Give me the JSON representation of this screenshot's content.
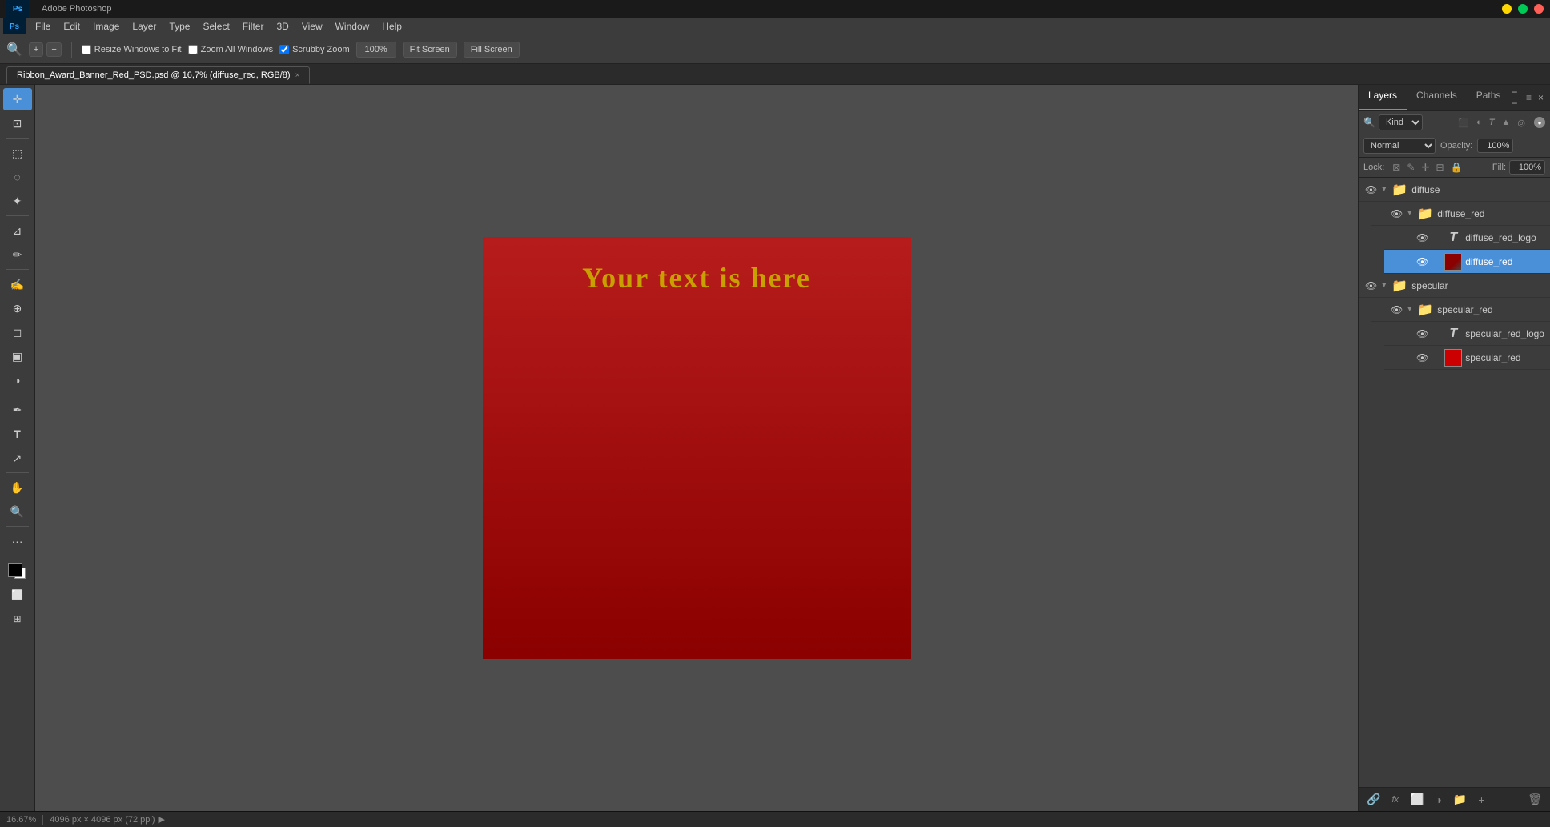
{
  "app": {
    "title": "Adobe Photoshop",
    "ps_logo": "Ps"
  },
  "menubar": {
    "items": [
      "File",
      "Edit",
      "Image",
      "Layer",
      "Type",
      "Select",
      "Filter",
      "3D",
      "View",
      "Window",
      "Help"
    ]
  },
  "optionsbar": {
    "zoom_icon": "🔍",
    "resize_windows_label": "Resize Windows to Fit",
    "zoom_all_label": "Zoom All Windows",
    "scrubby_zoom_label": "Scrubby Zoom",
    "zoom_value": "100%",
    "fit_screen_label": "Fit Screen",
    "fill_screen_label": "Fill Screen"
  },
  "tab": {
    "filename": "Ribbon_Award_Banner_Red_PSD.psd @ 16,7% (diffuse_red, RGB/8)",
    "close_label": "×"
  },
  "canvas": {
    "text": "Your text is here",
    "bg_color": "#8b0000"
  },
  "layers_panel": {
    "tabs": [
      "Layers",
      "Channels",
      "Paths"
    ],
    "active_tab": "Layers",
    "filter_label": "Kind",
    "blend_mode": "Normal",
    "opacity_label": "Opacity:",
    "opacity_value": "100%",
    "lock_label": "Lock:",
    "fill_label": "Fill:",
    "fill_value": "100%",
    "layers": [
      {
        "id": 1,
        "name": "diffuse",
        "type": "group",
        "indent": 0,
        "visible": true,
        "expanded": true
      },
      {
        "id": 2,
        "name": "diffuse_red",
        "type": "group",
        "indent": 1,
        "visible": true,
        "expanded": true
      },
      {
        "id": 3,
        "name": "diffuse_red_logo",
        "type": "text",
        "indent": 2,
        "visible": true
      },
      {
        "id": 4,
        "name": "diffuse_red",
        "type": "pixel",
        "indent": 2,
        "visible": true,
        "selected": true,
        "color": "dark-red"
      },
      {
        "id": 5,
        "name": "specular",
        "type": "group",
        "indent": 0,
        "visible": true,
        "expanded": true
      },
      {
        "id": 6,
        "name": "specular_red",
        "type": "group",
        "indent": 1,
        "visible": true,
        "expanded": true
      },
      {
        "id": 7,
        "name": "specular_red_logo",
        "type": "text",
        "indent": 2,
        "visible": true
      },
      {
        "id": 8,
        "name": "specular_red",
        "type": "pixel",
        "indent": 2,
        "visible": true,
        "color": "bright-red"
      }
    ],
    "bottom_icons": [
      "fx",
      "add-layer-style",
      "add-mask",
      "new-group",
      "new-layer",
      "delete"
    ]
  },
  "statusbar": {
    "zoom": "16.67%",
    "doc_info": "4096 px × 4096 px (72 ppi)"
  },
  "toolbar": {
    "tools": [
      {
        "name": "move",
        "icon": "✛"
      },
      {
        "name": "artboard",
        "icon": "⊡"
      },
      {
        "name": "lasso",
        "icon": "◌"
      },
      {
        "name": "marquee",
        "icon": "⬚"
      },
      {
        "name": "crop",
        "icon": "⊿"
      },
      {
        "name": "eyedropper",
        "icon": "✏"
      },
      {
        "name": "brush",
        "icon": "✍"
      },
      {
        "name": "stamp",
        "icon": "⊕"
      },
      {
        "name": "eraser",
        "icon": "◻"
      },
      {
        "name": "gradient",
        "icon": "▣"
      },
      {
        "name": "dodge",
        "icon": "◑"
      },
      {
        "name": "pen",
        "icon": "✒"
      },
      {
        "name": "type",
        "icon": "T"
      },
      {
        "name": "path-select",
        "icon": "↗"
      },
      {
        "name": "hand",
        "icon": "✋"
      },
      {
        "name": "zoom",
        "icon": "🔍"
      }
    ]
  },
  "colors": {
    "accent_blue": "#31a8ff",
    "bg_dark": "#2b2b2b",
    "bg_mid": "#3c3c3c",
    "selected": "#4a90d9",
    "canvas_red": "#8b0000",
    "text_gold": "#c8a000"
  }
}
